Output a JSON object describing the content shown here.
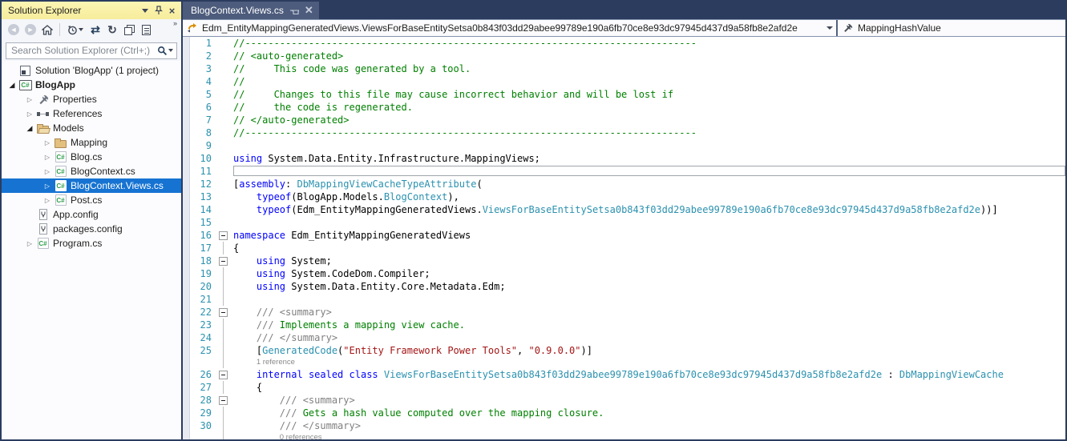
{
  "solution_explorer": {
    "title": "Solution Explorer",
    "search_placeholder": "Search Solution Explorer (Ctrl+;)",
    "toolbar_icons": [
      "back",
      "forward",
      "home",
      "separator",
      "pending-changes-filter",
      "sync-with-active-document",
      "refresh",
      "collapse-all",
      "show-all-files"
    ],
    "tree": [
      {
        "label": "Solution 'BlogApp' (1 project)",
        "icon": "solution",
        "indent": 0,
        "expander": "none"
      },
      {
        "label": "BlogApp",
        "icon": "project",
        "indent": 0,
        "expander": "expanded",
        "bold": true
      },
      {
        "label": "Properties",
        "icon": "wrench",
        "indent": 1,
        "expander": "collapsed"
      },
      {
        "label": "References",
        "icon": "references",
        "indent": 1,
        "expander": "collapsed"
      },
      {
        "label": "Models",
        "icon": "folder-open",
        "indent": 1,
        "expander": "expanded"
      },
      {
        "label": "Mapping",
        "icon": "folder",
        "indent": 2,
        "expander": "collapsed"
      },
      {
        "label": "Blog.cs",
        "icon": "csharp",
        "indent": 2,
        "expander": "collapsed"
      },
      {
        "label": "BlogContext.cs",
        "icon": "csharp",
        "indent": 2,
        "expander": "collapsed"
      },
      {
        "label": "BlogContext.Views.cs",
        "icon": "csharp",
        "indent": 2,
        "expander": "collapsed",
        "selected": true
      },
      {
        "label": "Post.cs",
        "icon": "csharp",
        "indent": 2,
        "expander": "collapsed"
      },
      {
        "label": "App.config",
        "icon": "config",
        "indent": 1,
        "expander": "none"
      },
      {
        "label": "packages.config",
        "icon": "config",
        "indent": 1,
        "expander": "none"
      },
      {
        "label": "Program.cs",
        "icon": "csharp",
        "indent": 1,
        "expander": "collapsed"
      }
    ]
  },
  "editor": {
    "tab_title": "BlogContext.Views.cs",
    "navbar": {
      "type_path": "Edm_EntityMappingGeneratedViews.ViewsForBaseEntitySetsa0b843f03dd29abee99789e190a6fb70ce8e93dc97945d437d9a58fb8e2afd2e",
      "member": "MappingHashValue"
    },
    "lines": [
      {
        "n": 1,
        "fold": "",
        "segs": [
          [
            "cm",
            "//------------------------------------------------------------------------------"
          ]
        ]
      },
      {
        "n": 2,
        "fold": "",
        "segs": [
          [
            "cm",
            "// <auto-generated>"
          ]
        ]
      },
      {
        "n": 3,
        "fold": "",
        "segs": [
          [
            "cm",
            "//     This code was generated by a tool."
          ]
        ]
      },
      {
        "n": 4,
        "fold": "",
        "segs": [
          [
            "cm",
            "//"
          ]
        ]
      },
      {
        "n": 5,
        "fold": "",
        "segs": [
          [
            "cm",
            "//     Changes to this file may cause incorrect behavior and will be lost if"
          ]
        ]
      },
      {
        "n": 6,
        "fold": "",
        "segs": [
          [
            "cm",
            "//     the code is regenerated."
          ]
        ]
      },
      {
        "n": 7,
        "fold": "",
        "segs": [
          [
            "cm",
            "// </auto-generated>"
          ]
        ]
      },
      {
        "n": 8,
        "fold": "",
        "segs": [
          [
            "cm",
            "//------------------------------------------------------------------------------"
          ]
        ]
      },
      {
        "n": 9,
        "fold": "",
        "segs": []
      },
      {
        "n": 10,
        "fold": "",
        "segs": [
          [
            "kw",
            "using"
          ],
          [
            "df",
            " System.Data.Entity.Infrastructure.MappingViews;"
          ]
        ]
      },
      {
        "n": 11,
        "fold": "",
        "segs": [],
        "caretBox": true
      },
      {
        "n": 12,
        "fold": "",
        "segs": [
          [
            "df",
            "["
          ],
          [
            "kw",
            "assembly"
          ],
          [
            "df",
            ": "
          ],
          [
            "ty",
            "DbMappingViewCacheTypeAttribute"
          ],
          [
            "df",
            "("
          ]
        ]
      },
      {
        "n": 13,
        "fold": "",
        "segs": [
          [
            "df",
            "    "
          ],
          [
            "kw",
            "typeof"
          ],
          [
            "df",
            "(BlogApp.Models."
          ],
          [
            "ty",
            "BlogContext"
          ],
          [
            "df",
            "),"
          ]
        ]
      },
      {
        "n": 14,
        "fold": "",
        "segs": [
          [
            "df",
            "    "
          ],
          [
            "kw",
            "typeof"
          ],
          [
            "df",
            "(Edm_EntityMappingGeneratedViews."
          ],
          [
            "ty",
            "ViewsForBaseEntitySetsa0b843f03dd29abee99789e190a6fb70ce8e93dc97945d437d9a58fb8e2afd2e"
          ],
          [
            "df",
            "))]"
          ]
        ]
      },
      {
        "n": 15,
        "fold": "",
        "segs": []
      },
      {
        "n": 16,
        "fold": "box",
        "segs": [
          [
            "kw",
            "namespace"
          ],
          [
            "df",
            " Edm_EntityMappingGeneratedViews"
          ]
        ]
      },
      {
        "n": 17,
        "fold": "line",
        "segs": [
          [
            "df",
            "{"
          ]
        ]
      },
      {
        "n": 18,
        "fold": "box",
        "segs": [
          [
            "df",
            "    "
          ],
          [
            "kw",
            "using"
          ],
          [
            "df",
            " System;"
          ]
        ]
      },
      {
        "n": 19,
        "fold": "line",
        "segs": [
          [
            "df",
            "    "
          ],
          [
            "kw",
            "using"
          ],
          [
            "df",
            " System.CodeDom.Compiler;"
          ]
        ]
      },
      {
        "n": 20,
        "fold": "line",
        "segs": [
          [
            "df",
            "    "
          ],
          [
            "kw",
            "using"
          ],
          [
            "df",
            " System.Data.Entity.Core.Metadata.Edm;"
          ]
        ]
      },
      {
        "n": 21,
        "fold": "line",
        "segs": []
      },
      {
        "n": 22,
        "fold": "box",
        "segs": [
          [
            "gy",
            "    /// <summary>"
          ]
        ]
      },
      {
        "n": 23,
        "fold": "line",
        "segs": [
          [
            "gy",
            "    /// "
          ],
          [
            "cm",
            "Implements a mapping view cache."
          ]
        ]
      },
      {
        "n": 24,
        "fold": "line",
        "segs": [
          [
            "gy",
            "    /// </summary>"
          ]
        ]
      },
      {
        "n": 25,
        "fold": "line",
        "segs": [
          [
            "df",
            "    ["
          ],
          [
            "ty",
            "GeneratedCode"
          ],
          [
            "df",
            "("
          ],
          [
            "st",
            "\"Entity Framework Power Tools\""
          ],
          [
            "df",
            ", "
          ],
          [
            "st",
            "\"0.9.0.0\""
          ],
          [
            "df",
            ")]"
          ]
        ]
      },
      {
        "lens": "1 reference",
        "lensIndent": 4,
        "fold": "line"
      },
      {
        "n": 26,
        "fold": "box",
        "segs": [
          [
            "df",
            "    "
          ],
          [
            "kw",
            "internal"
          ],
          [
            "df",
            " "
          ],
          [
            "kw",
            "sealed"
          ],
          [
            "df",
            " "
          ],
          [
            "kw",
            "class"
          ],
          [
            "df",
            " "
          ],
          [
            "ty",
            "ViewsForBaseEntitySetsa0b843f03dd29abee99789e190a6fb70ce8e93dc97945d437d9a58fb8e2afd2e"
          ],
          [
            "df",
            " : "
          ],
          [
            "ty",
            "DbMappingViewCache"
          ]
        ]
      },
      {
        "n": 27,
        "fold": "line",
        "segs": [
          [
            "df",
            "    {"
          ]
        ]
      },
      {
        "n": 28,
        "fold": "box",
        "segs": [
          [
            "gy",
            "        /// <summary>"
          ]
        ]
      },
      {
        "n": 29,
        "fold": "line",
        "segs": [
          [
            "gy",
            "        /// "
          ],
          [
            "cm",
            "Gets a hash value computed over the mapping closure."
          ]
        ]
      },
      {
        "n": 30,
        "fold": "line",
        "segs": [
          [
            "gy",
            "        /// </summary>"
          ]
        ]
      },
      {
        "lens": "0 references",
        "lensIndent": 8,
        "fold": "line"
      }
    ]
  },
  "colors": {
    "accent_selection": "#1673D2",
    "active_toolwindow_header": "#F9F0A0",
    "environment_background": "#2B3C5F",
    "keyword": "#0000FF",
    "type": "#2B91AF",
    "comment": "#008000",
    "string": "#A31515",
    "line_number": "#2B91AF"
  }
}
